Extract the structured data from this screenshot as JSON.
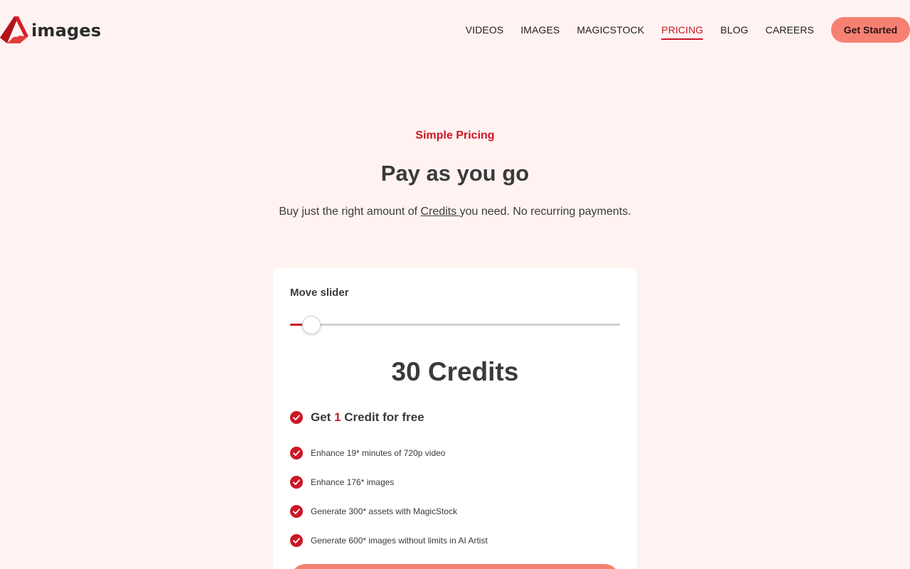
{
  "brand": {
    "name": "images",
    "accent_color": "#cc1626",
    "cta_color": "#f68173"
  },
  "nav": {
    "items": [
      {
        "label": "VIDEOS",
        "active": false
      },
      {
        "label": "IMAGES",
        "active": false
      },
      {
        "label": "MAGICSTOCK",
        "active": false
      },
      {
        "label": "PRICING",
        "active": true
      },
      {
        "label": "BLOG",
        "active": false
      },
      {
        "label": "CAREERS",
        "active": false
      }
    ],
    "cta_label": "Get Started"
  },
  "hero": {
    "eyebrow": "Simple Pricing",
    "title": "Pay as you go",
    "subtitle_before": "Buy just the right amount of ",
    "subtitle_link": "Credits ",
    "subtitle_after": "you need. No recurring payments."
  },
  "pricing_card": {
    "slider_label": "Move slider",
    "slider_level": 0.065,
    "credits_label": "30 Credits",
    "free_prefix": "Get ",
    "free_amount": "1",
    "free_suffix": " Credit for free",
    "features": [
      "Enhance 19* minutes of 720p video",
      "Enhance 176* images",
      "Generate 300* assets with MagicStock",
      "Generate 600* images without limits in AI Artist"
    ]
  },
  "icons": {
    "logo": "logo-icon",
    "check": "check-circle-icon"
  }
}
